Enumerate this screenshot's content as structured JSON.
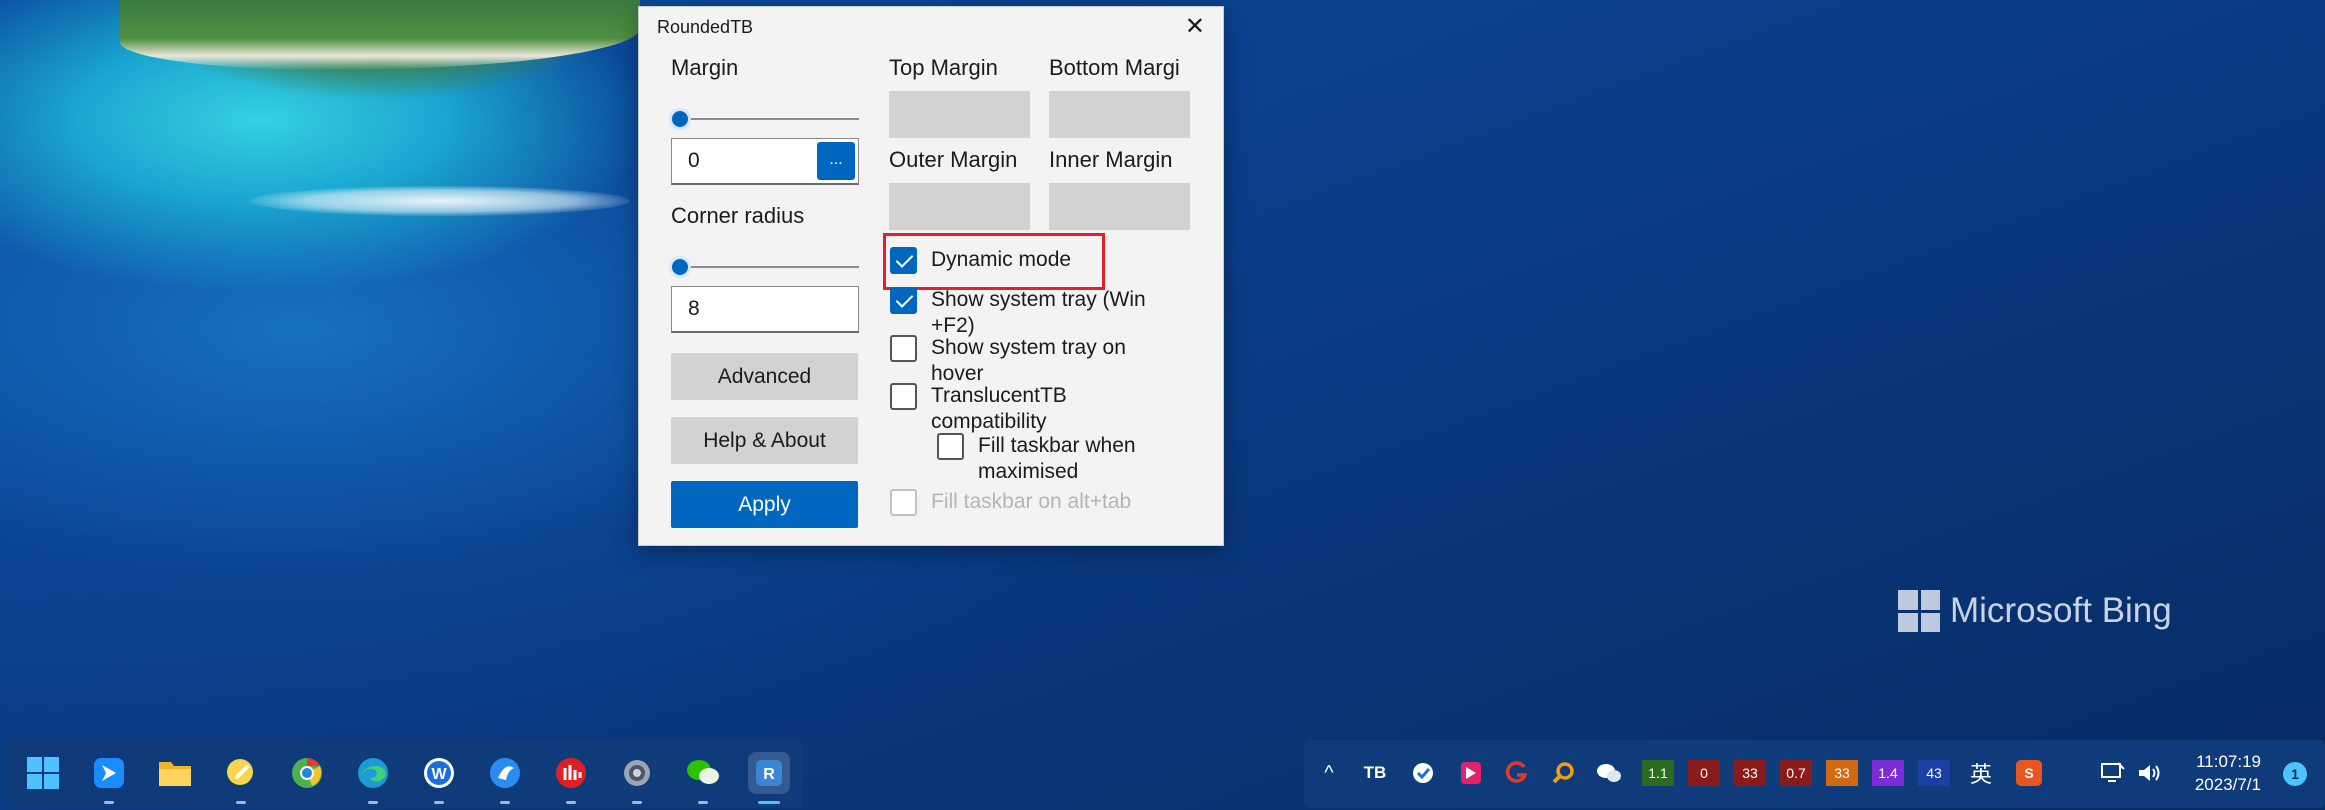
{
  "dialog": {
    "title": "RoundedTB",
    "close": "✕",
    "margin_label": "Margin",
    "margin_value": "0",
    "margin_more": "...",
    "corner_label": "Corner radius",
    "corner_value": "8",
    "top_margin": "Top Margin",
    "bottom_margin": "Bottom Margi",
    "outer_margin": "Outer Margin",
    "inner_margin": "Inner Margin",
    "advanced": "Advanced",
    "help": "Help & About",
    "apply": "Apply",
    "checks": [
      {
        "label": "Dynamic mode",
        "checked": true
      },
      {
        "label": "Show system tray (Win +F2)",
        "checked": true
      },
      {
        "label": "Show system tray on hover",
        "checked": false
      },
      {
        "label": "TranslucentTB compatibility",
        "checked": false
      },
      {
        "label": "Fill taskbar when maximised",
        "checked": false
      },
      {
        "label": "Fill taskbar on alt+tab",
        "checked": false,
        "disabled": true
      }
    ]
  },
  "wallpaper": {
    "brand": "Microsoft Bing"
  },
  "taskbar": {
    "apps": [
      {
        "name": "start-icon"
      },
      {
        "name": "feishu-icon"
      },
      {
        "name": "file-explorer-icon"
      },
      {
        "name": "notes-icon"
      },
      {
        "name": "chrome-icon"
      },
      {
        "name": "edge-icon"
      },
      {
        "name": "wps-icon",
        "glyph": "W"
      },
      {
        "name": "app-icon"
      },
      {
        "name": "netease-music-icon"
      },
      {
        "name": "settings-icon"
      },
      {
        "name": "wechat-icon"
      },
      {
        "name": "roundedtb-icon",
        "glyph": "R",
        "active": true
      }
    ],
    "tray": {
      "chevron": "^",
      "tb": "TB",
      "monitors": [
        {
          "value": "1.1",
          "color": "#2d6b1e"
        },
        {
          "value": "0",
          "color": "#8a1b1b"
        },
        {
          "value": "33",
          "color": "#8a1b1b"
        },
        {
          "value": "0.7",
          "color": "#8a1b1b"
        },
        {
          "value": "33",
          "color": "#d06a12"
        },
        {
          "value": "1.4",
          "color": "#7b2ed6"
        },
        {
          "value": "43",
          "color": "#1c3fa6"
        }
      ],
      "ime": "英",
      "sogou": "S",
      "time": "11:07:19",
      "date": "2023/7/1",
      "notifications": "1"
    }
  }
}
